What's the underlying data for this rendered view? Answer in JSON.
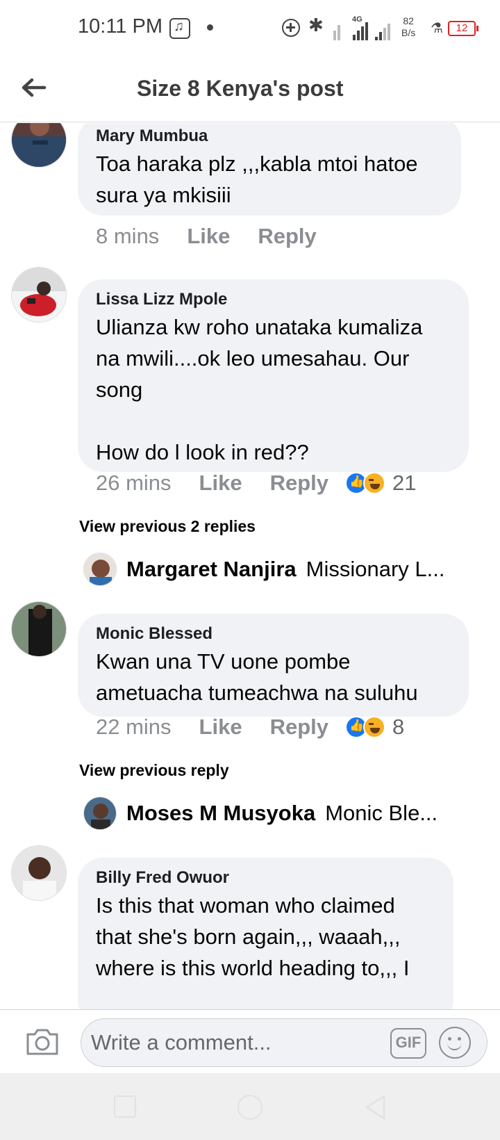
{
  "status_bar": {
    "time": "10:11 PM",
    "network_type": "4G",
    "speed_value": "82",
    "speed_unit": "B/s",
    "battery": "12"
  },
  "header": {
    "title": "Size 8 Kenya's post",
    "back_icon": "arrow-left-icon"
  },
  "comments": [
    {
      "name": "Mary Mumbua",
      "text": "Toa haraka plz ,,,kabla mtoi hatoe sura ya mkisiii",
      "time": "8 mins",
      "like": "Like",
      "reply": "Reply"
    },
    {
      "name": "Lissa Lizz Mpole",
      "text": "Ulianza kw roho unataka kumaliza na mwili....ok leo umesahau.   Our song\n\nHow do l look in red??",
      "time": "26 mins",
      "like": "Like",
      "reply": "Reply",
      "reactions": "21",
      "view_previous": "View previous 2 replies",
      "reply_preview": {
        "name": "Margaret Nanjira",
        "text": "Missionary L..."
      }
    },
    {
      "name": "Monic Blessed",
      "text": "Kwan una TV uone pombe ametuacha tumeachwa na suluhu",
      "time": "22 mins",
      "like": "Like",
      "reply": "Reply",
      "reactions": "8",
      "view_previous": "View previous reply",
      "reply_preview": {
        "name": "Moses M Musyoka",
        "text": "Monic Ble..."
      }
    },
    {
      "name": "Billy Fred Owuor",
      "text": "Is this that woman who claimed that she's born again,,, waaah,,, where is this world heading to,,, I"
    }
  ],
  "composer": {
    "placeholder": "Write a comment...",
    "gif_label": "GIF"
  },
  "colors": {
    "bubble": "#f0f2f5",
    "like_blue": "#1877f2",
    "haha_yellow": "#f7b125",
    "meta_gray": "#8a8d91",
    "battery_red": "#e02020"
  },
  "icons": [
    "music-icon",
    "dnd-icon",
    "bluetooth-icon",
    "signal-icon",
    "flask-icon",
    "battery-icon",
    "camera-icon",
    "gif-icon",
    "smile-icon"
  ]
}
